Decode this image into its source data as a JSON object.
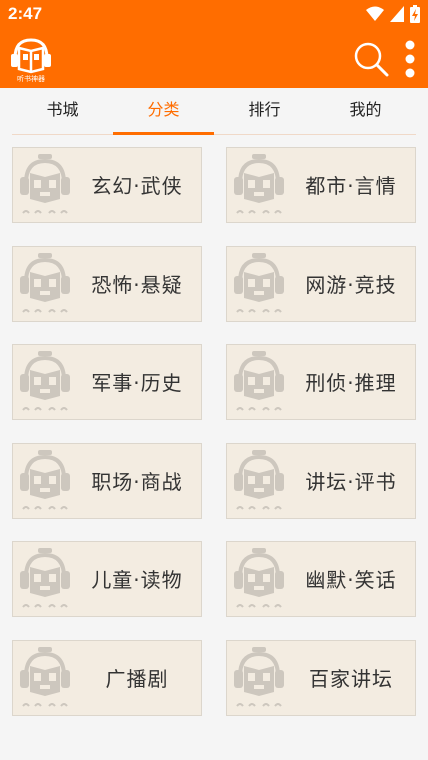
{
  "status": {
    "time": "2:47"
  },
  "app": {
    "logo_text": "听书神器"
  },
  "tabs": [
    {
      "label": "书城"
    },
    {
      "label": "分类"
    },
    {
      "label": "排行"
    },
    {
      "label": "我的"
    }
  ],
  "active_tab": "分类",
  "categories": [
    {
      "label": "玄幻·武侠"
    },
    {
      "label": "都市·言情"
    },
    {
      "label": "恐怖·悬疑"
    },
    {
      "label": "网游·竞技"
    },
    {
      "label": "军事·历史"
    },
    {
      "label": "刑侦·推理"
    },
    {
      "label": "职场·商战"
    },
    {
      "label": "讲坛·评书"
    },
    {
      "label": "儿童·读物"
    },
    {
      "label": "幽默·笑话"
    },
    {
      "label": "广播剧"
    },
    {
      "label": "百家讲坛"
    }
  ],
  "colors": {
    "accent": "#ff6d00",
    "card_bg": "#f3ece1",
    "mascot": "#cdc7be"
  },
  "icons": {
    "search": "search-icon",
    "more": "more-vert-icon",
    "logo": "book-headphones-logo"
  }
}
